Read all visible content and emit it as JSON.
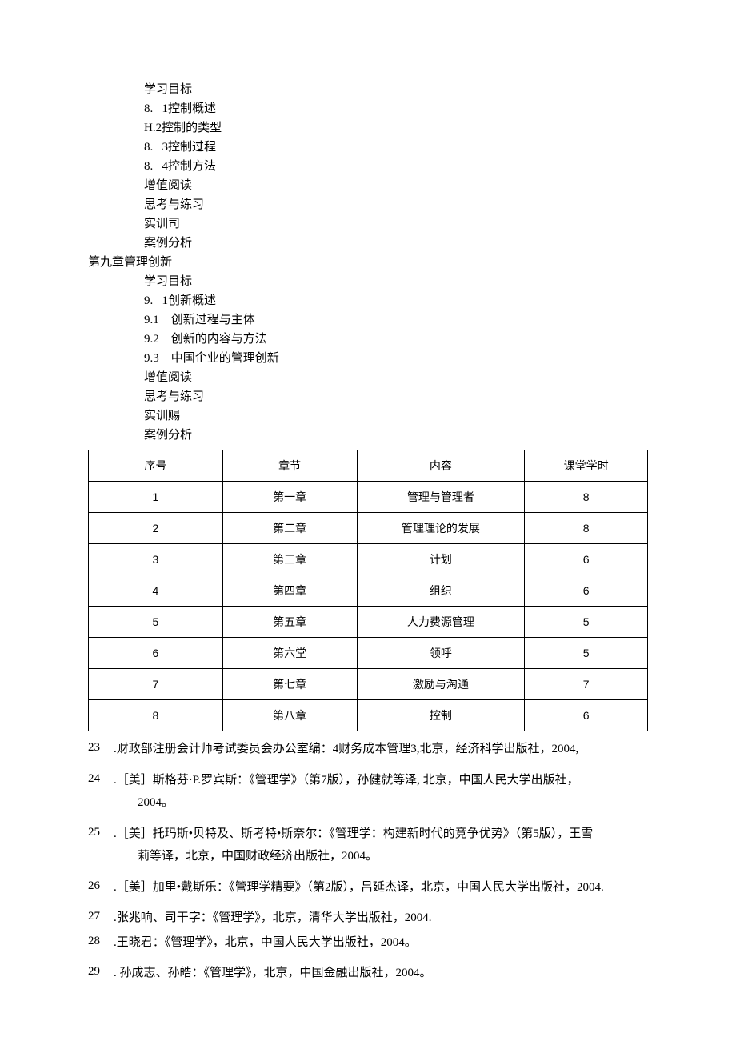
{
  "outline_ch8": [
    "学习目标",
    "8.   1控制概述",
    "H.2控制的类型",
    "8.   3控制过程",
    "8.   4控制方法",
    "增值阅读",
    "思考与练习",
    "实训司",
    "案例分析"
  ],
  "chapter9_title": "第九章管理创新",
  "outline_ch9": [
    "学习目标",
    "9.   1创新概述",
    "9.1    创新过程与主体",
    "9.2    创新的内容与方法",
    "9.3    中国企业的管理创新",
    "增值阅读",
    "思考与练习",
    "实训赐",
    "案例分析"
  ],
  "table": {
    "headers": [
      "序号",
      "章节",
      "内容",
      "课堂学时"
    ],
    "rows": [
      [
        "1",
        "第一章",
        "管理与管理者",
        "8"
      ],
      [
        "2",
        "第二章",
        "管理理论的发展",
        "8"
      ],
      [
        "3",
        "第三章",
        "计划",
        "6"
      ],
      [
        "4",
        "第四章",
        "组织",
        "6"
      ],
      [
        "5",
        "第五章",
        "人力费源管理",
        "5"
      ],
      [
        "6",
        "第六堂",
        "领呼",
        "5"
      ],
      [
        "7",
        "第七章",
        "激励与淘通",
        "7"
      ],
      [
        "8",
        "第八章",
        "控制",
        "6"
      ]
    ]
  },
  "references": [
    {
      "num": "23",
      "text": ".财政部注册会计师考试委员会办公室编：4财务成本管理3,北京，经济科学出版社，2004,"
    },
    {
      "num": "24",
      "text": ".［美］斯格芬·P.罗宾斯：《管理学》（第7版），孙健就等泽, 北京，中国人民大学出版社，",
      "cont": "2004。"
    },
    {
      "num": "25",
      "text": ".［美］托玛斯•贝特及、斯考特•斯奈尔：《管理学：构建新时代的竞争优势》（第5版），王雪",
      "cont": "莉等译，北京，中国财政经济出版社，2004。"
    },
    {
      "num": "26",
      "text": ".［美］加里•戴斯乐：《管理学精要》（第2版），吕延杰译，北京，中国人民大学出版社，2004."
    },
    {
      "num": "27",
      "text": ".张兆响、司干字：《管理学》，北京，清华大学出版社，2004."
    },
    {
      "num": "28",
      "text": ".王晓君：《管理学》，北京，中国人民大学出版社，2004。"
    },
    {
      "num": "29",
      "text": ". 孙成志、孙皓：《管理学》，北京，中国金融出版社，2004。"
    }
  ]
}
